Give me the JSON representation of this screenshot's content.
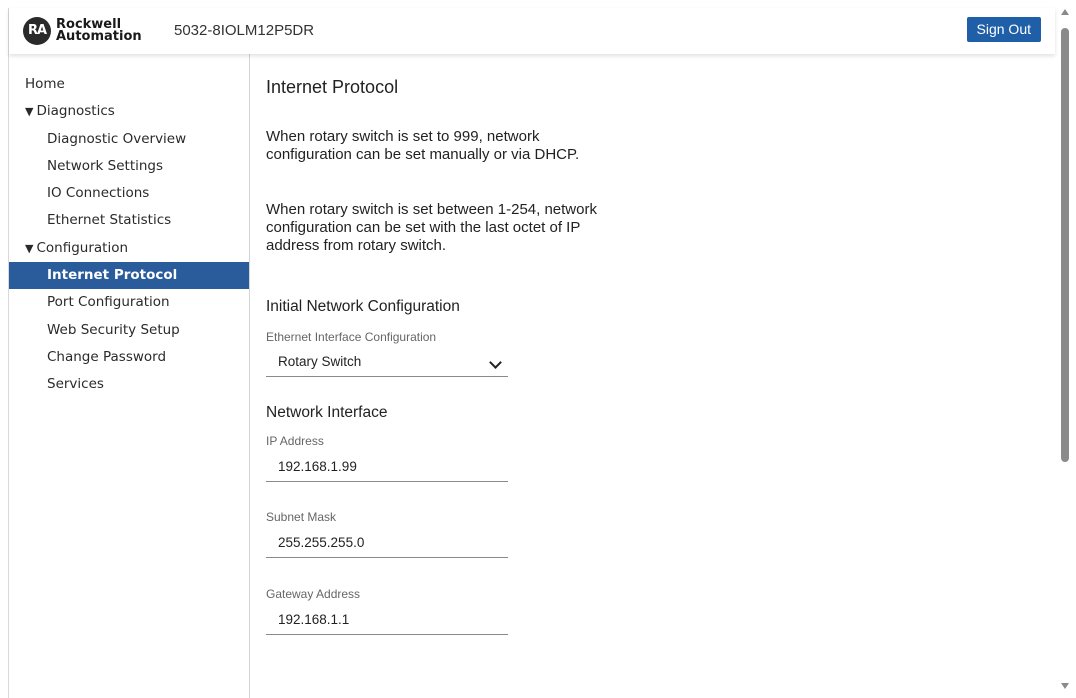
{
  "header": {
    "logo_badge": "RA",
    "logo_line1": "Rockwell",
    "logo_line2": "Automation",
    "device_name": "5032-8IOLM12P5DR",
    "sign_out_label": "Sign Out"
  },
  "sidebar": {
    "home": "Home",
    "diagnostics": "Diagnostics",
    "diagnostics_items": {
      "overview": "Diagnostic Overview",
      "network": "Network Settings",
      "io": "IO Connections",
      "ethernet": "Ethernet Statistics"
    },
    "configuration": "Configuration",
    "configuration_items": {
      "ip": "Internet Protocol",
      "port": "Port Configuration",
      "websec": "Web Security Setup",
      "password": "Change Password",
      "services": "Services"
    },
    "expanded_glyph": "▼",
    "active_item": "Internet Protocol"
  },
  "main": {
    "title": "Internet Protocol",
    "info1": "When rotary switch is set to 999, network configuration can be set manually or via DHCP.",
    "info2": "When rotary switch is set between 1-254, network configuration can be set with the last octet of IP address from rotary switch.",
    "initial_section": "Initial Network Configuration",
    "eth_label": "Ethernet Interface Configuration",
    "eth_value": "Rotary Switch",
    "network_section": "Network Interface",
    "ip_label": "IP Address",
    "ip_value": "192.168.1.99",
    "subnet_label": "Subnet Mask",
    "subnet_value": "255.255.255.0",
    "gateway_label": "Gateway Address",
    "gateway_value": "192.168.1.1"
  },
  "colors": {
    "accent": "#1f5fa8",
    "active_nav": "#2a5b9a"
  },
  "icons": {
    "logo": "rockwell-logo-icon",
    "select": "chevron-down-icon",
    "expanded": "triangle-down-icon"
  }
}
